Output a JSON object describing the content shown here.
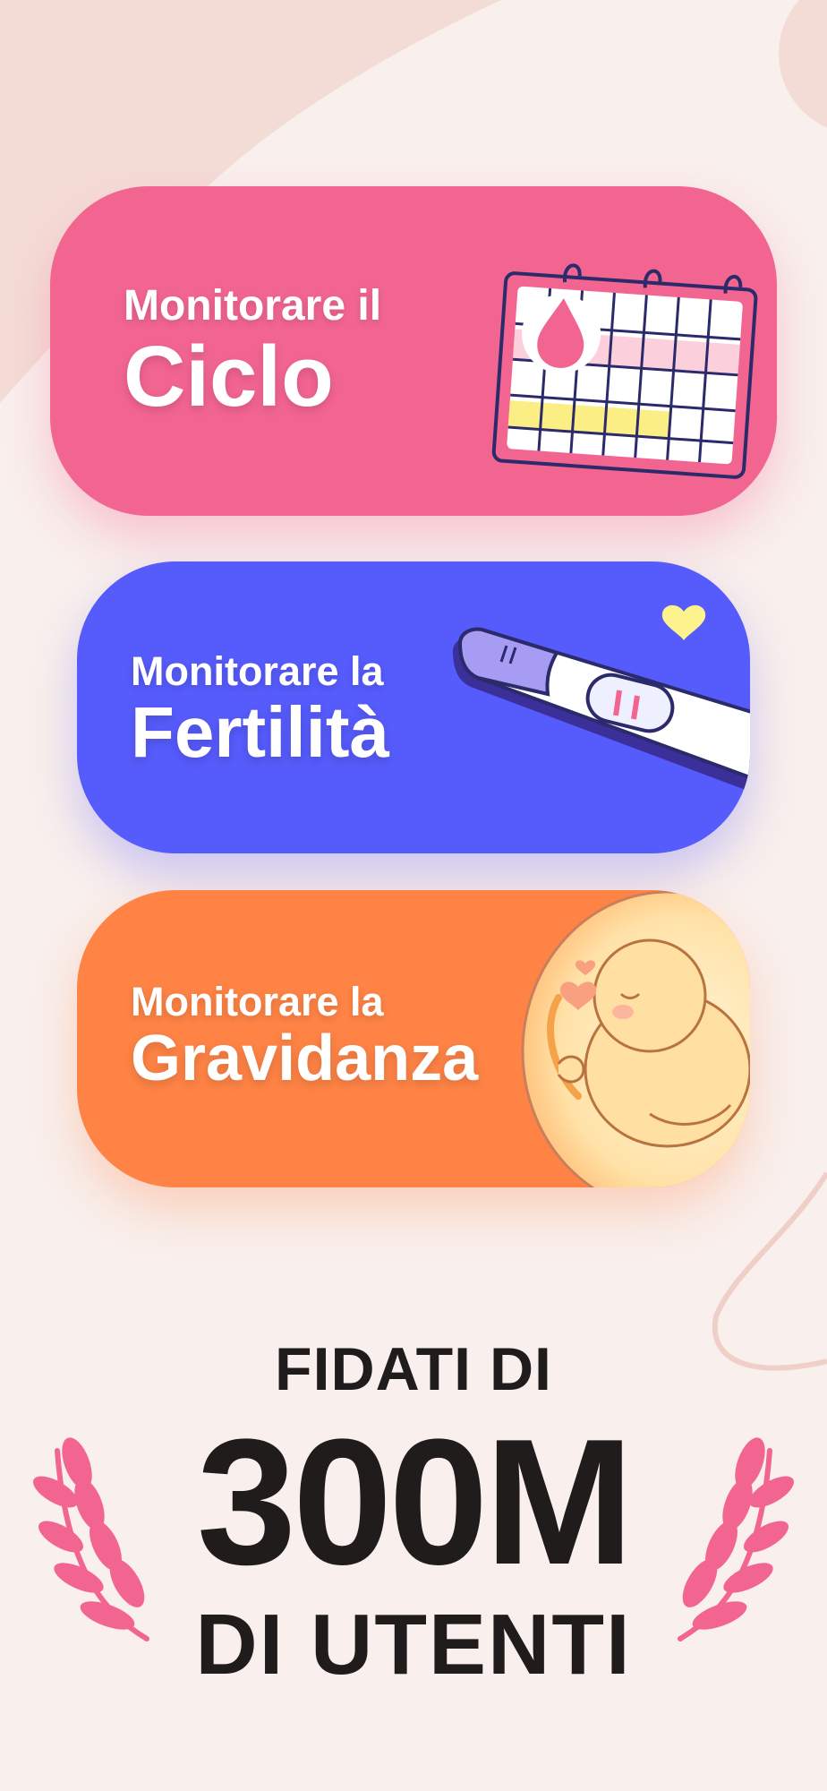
{
  "cards": [
    {
      "id": "ciclo",
      "line1": "Monitorare il",
      "line2": "Ciclo",
      "color": "#f26591",
      "icon": "calendar-period-icon"
    },
    {
      "id": "fertilita",
      "line1": "Monitorare la",
      "line2": "Fertilità",
      "color": "#565bfb",
      "icon": "ovulation-test-icon"
    },
    {
      "id": "gravidanza",
      "line1": "Monitorare la",
      "line2": "Gravidanza",
      "color": "#fe8345",
      "icon": "baby-fetus-icon"
    }
  ],
  "trust": {
    "top": "FIDATI DI",
    "number": "300M",
    "bottom": "DI UTENTI"
  },
  "colors": {
    "background": "#f9efec",
    "text_dark": "#201c1c",
    "laurel": "#f26591"
  }
}
